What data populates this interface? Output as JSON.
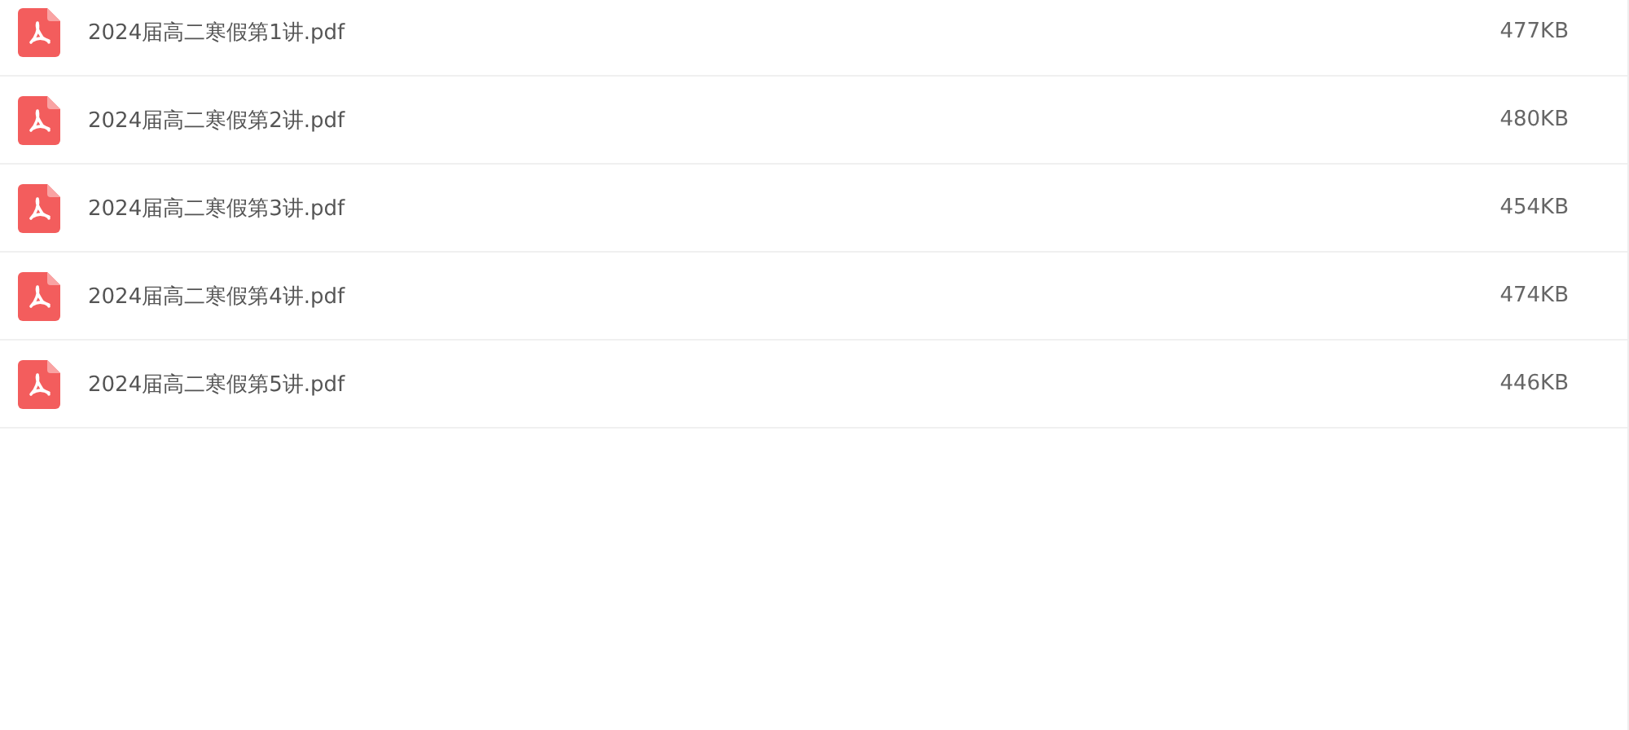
{
  "files": [
    {
      "name": "2024届高二寒假第1讲.pdf",
      "size": "477KB"
    },
    {
      "name": "2024届高二寒假第2讲.pdf",
      "size": "480KB"
    },
    {
      "name": "2024届高二寒假第3讲.pdf",
      "size": "454KB"
    },
    {
      "name": "2024届高二寒假第4讲.pdf",
      "size": "474KB"
    },
    {
      "name": "2024届高二寒假第5讲.pdf",
      "size": "446KB"
    }
  ]
}
